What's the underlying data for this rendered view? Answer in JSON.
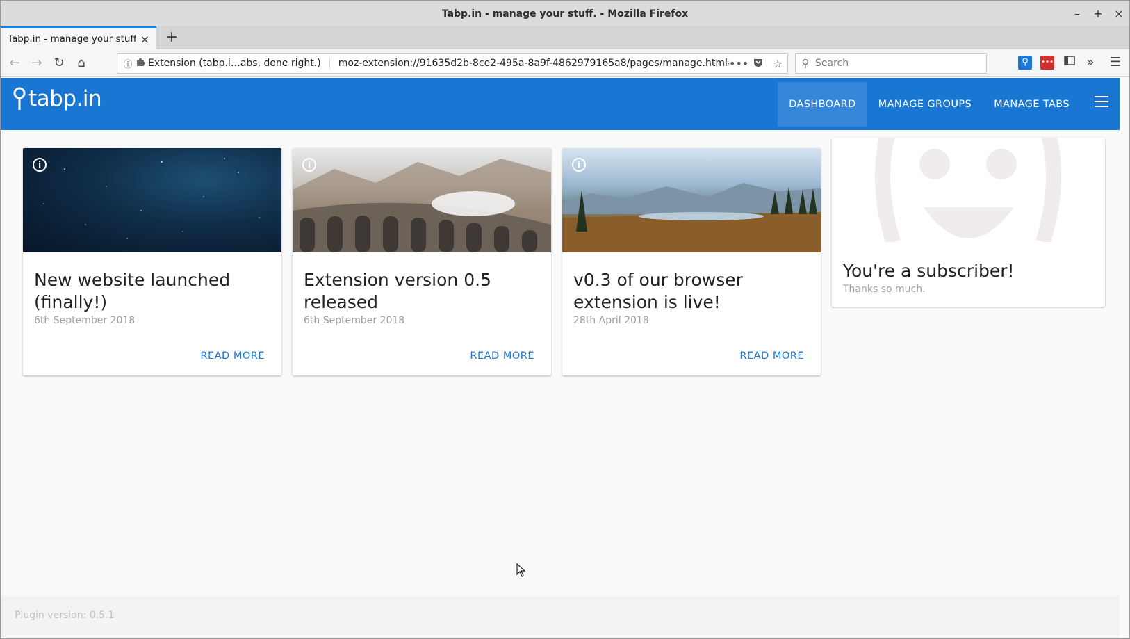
{
  "window": {
    "title": "Tabp.in - manage your stuff. - Mozilla Firefox",
    "controls": [
      "–",
      "+",
      "×"
    ]
  },
  "tabs": [
    {
      "label": "Tabp.in - manage your stuff.",
      "close": "×"
    }
  ],
  "newtab_glyph": "+",
  "navbar": {
    "back": "←",
    "forward": "→",
    "reload": "↻",
    "home": "⌂",
    "identity_label": "Extension (tabp.i…abs, done right.)",
    "url": "moz-extension://91635d2b-8ce2-495a-8a9f-4862979165a8/pages/manage.html#/",
    "page_actions": "•••",
    "search_placeholder": "Search"
  },
  "toolbar_icons": [
    "tabpin-extension-icon",
    "password-extension-icon",
    "sidebar-icon",
    "overflow-icon",
    "menu-icon"
  ],
  "app": {
    "logo_text": "tabp.in",
    "nav": [
      {
        "label": "DASHBOARD",
        "active": true
      },
      {
        "label": "MANAGE GROUPS",
        "active": false
      },
      {
        "label": "MANAGE TABS",
        "active": false
      }
    ]
  },
  "cards": [
    {
      "title": "New website launched (finally!)",
      "date": "6th September 2018",
      "action": "READ MORE",
      "image": "starry-sky"
    },
    {
      "title": "Extension version 0.5 released",
      "date": "6th September 2018",
      "action": "READ MORE",
      "image": "train-viaduct"
    },
    {
      "title": "v0.3 of our browser extension is live!",
      "date": "28th April 2018",
      "action": "READ MORE",
      "image": "mountain-lake"
    }
  ],
  "subscriber": {
    "title": "You're a subscriber!",
    "text": "Thanks so much."
  },
  "footer": {
    "plugin_version": "Plugin version: 0.5.1"
  },
  "colors": {
    "primary": "#1976d2",
    "nav_active": "#3585d8"
  }
}
